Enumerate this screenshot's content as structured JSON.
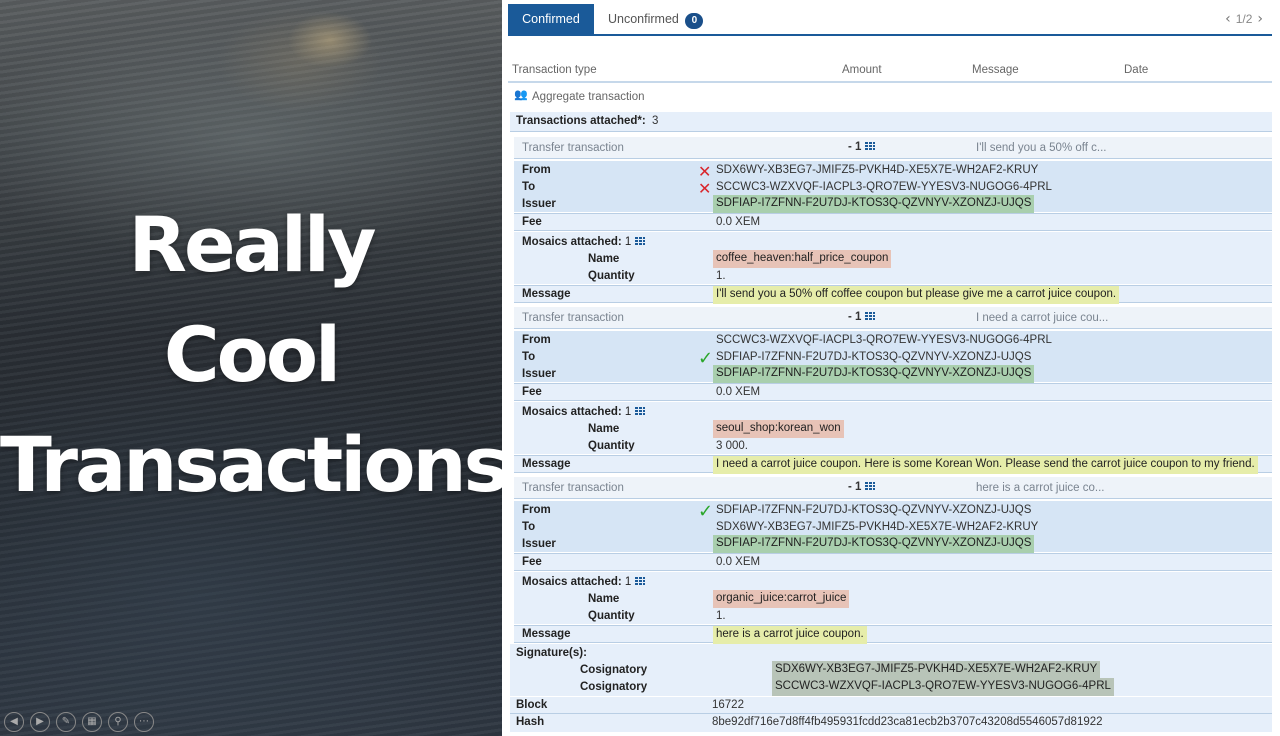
{
  "slide": {
    "title_lines": [
      "Really",
      "Cool",
      "Transactions"
    ],
    "controls": [
      "prev-icon",
      "next-icon",
      "pen-icon",
      "slides-icon",
      "zoom-icon",
      "more-icon"
    ]
  },
  "tabs": {
    "confirmed": "Confirmed",
    "unconfirmed": "Unconfirmed",
    "unconfirmed_count": "0",
    "active": "Confirmed"
  },
  "pager": {
    "text": "1/2"
  },
  "columns": [
    "Transaction type",
    "Amount",
    "Message",
    "Date"
  ],
  "aggregate": {
    "type": "Aggregate transaction",
    "attached_label": "Transactions attached*:",
    "attached_count": "3"
  },
  "labels": {
    "from": "From",
    "to": "To",
    "issuer": "Issuer",
    "fee": "Fee",
    "mosaics": "Mosaics attached:",
    "name": "Name",
    "quantity": "Quantity",
    "message": "Message",
    "signatures": "Signature(s):",
    "cosignatory": "Cosignatory",
    "block": "Block",
    "hash": "Hash"
  },
  "transactions": [
    {
      "type": "Transfer transaction",
      "amount": "- 1",
      "message_short": "I'll send you a 50% off c...",
      "from": "SDX6WY-XB3EG7-JMIFZ5-PVKH4D-XE5X7E-WH2AF2-KRUY",
      "to": "SCCWC3-WZXVQF-IACPL3-QRO7EW-YYESV3-NUGOG6-4PRL",
      "issuer": "SDFIAP-I7ZFNN-F2U7DJ-KTOS3Q-QZVNYV-XZONZJ-UJQS",
      "fee": "0.0 XEM",
      "mosaics_count": "1",
      "mosaic_name": "coffee_heaven:half_price_coupon",
      "quantity": "1.",
      "message": "I'll send you a 50% off coffee coupon but please give me a carrot juice coupon."
    },
    {
      "type": "Transfer transaction",
      "amount": "- 1",
      "message_short": "I need a carrot juice cou...",
      "from": "SCCWC3-WZXVQF-IACPL3-QRO7EW-YYESV3-NUGOG6-4PRL",
      "to": "SDFIAP-I7ZFNN-F2U7DJ-KTOS3Q-QZVNYV-XZONZJ-UJQS",
      "issuer": "SDFIAP-I7ZFNN-F2U7DJ-KTOS3Q-QZVNYV-XZONZJ-UJQS",
      "fee": "0.0 XEM",
      "mosaics_count": "1",
      "mosaic_name": "seoul_shop:korean_won",
      "quantity": "3 000.",
      "message": "I need a carrot juice coupon. Here is some Korean Won. Please send the carrot juice coupon to my friend."
    },
    {
      "type": "Transfer transaction",
      "amount": "- 1",
      "message_short": "here is a carrot juice co...",
      "from": "SDFIAP-I7ZFNN-F2U7DJ-KTOS3Q-QZVNYV-XZONZJ-UJQS",
      "to": "SDX6WY-XB3EG7-JMIFZ5-PVKH4D-XE5X7E-WH2AF2-KRUY",
      "issuer": "SDFIAP-I7ZFNN-F2U7DJ-KTOS3Q-QZVNYV-XZONZJ-UJQS",
      "fee": "0.0 XEM",
      "mosaics_count": "1",
      "mosaic_name": "organic_juice:carrot_juice",
      "quantity": "1.",
      "message": "here is a carrot juice coupon."
    }
  ],
  "signatures": [
    "SDX6WY-XB3EG7-JMIFZ5-PVKH4D-XE5X7E-WH2AF2-KRUY",
    "SCCWC3-WZXVQF-IACPL3-QRO7EW-YYESV3-NUGOG6-4PRL"
  ],
  "block": "16722",
  "hash": "8be92df716e7d8ff4fb495931fcdd23ca81ecb2b3707c43208d5546057d81922"
}
